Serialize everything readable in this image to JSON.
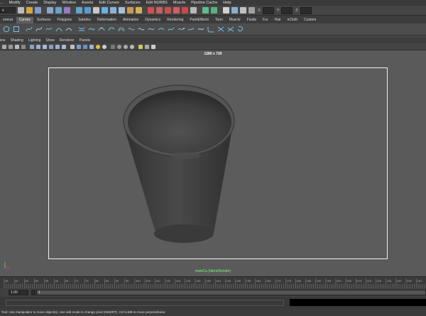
{
  "menubar": {
    "items": [
      "...",
      "Modify",
      "Create",
      "Display",
      "Window",
      "Assets",
      "Edit Curves",
      "Surfaces",
      "Edit NURBS",
      "Muscle",
      "Pipeline Cache",
      "Help"
    ]
  },
  "statusline": {
    "coord_labels": [
      "X:",
      "Y:",
      "Z:"
    ]
  },
  "shelf": {
    "tabs": [
      "eneral",
      "Curves",
      "Surfaces",
      "Polygons",
      "Subdivs",
      "Deformation",
      "Animation",
      "Dynamics",
      "Rendering",
      "PaintEffects",
      "Toon",
      "Muscle",
      "Fluids",
      "Fur",
      "Hair",
      "nCloth",
      "Custom"
    ],
    "active_tab": "Curves"
  },
  "panel": {
    "menus": [
      "iew",
      "Shading",
      "Lighting",
      "Show",
      "Renderer",
      "Panels"
    ]
  },
  "viewport": {
    "resolution_label": "1280 x 720",
    "camera_label": "mainCa (fabricRender)"
  },
  "timeline": {
    "ticks": [
      "35",
      "40",
      "45",
      "50",
      "55",
      "60",
      "65",
      "70",
      "75",
      "80",
      "85",
      "90",
      "95",
      "100",
      "105",
      "110",
      "115",
      "120",
      "125",
      "130",
      "135",
      "140",
      "145",
      "150",
      "155",
      "160",
      "165",
      "170",
      "175",
      "180",
      "185",
      "190",
      "195",
      "200",
      "205",
      "210",
      "215",
      "220",
      "225",
      "230",
      "235",
      "240"
    ]
  },
  "range": {
    "start_value": "1.00",
    "current_value": "1"
  },
  "helpline": {
    "text": "Tool: Use manipulator to move object(s). Use edit mode to change pivot (INSERT). Ctrl+LMB to move perpendicular."
  },
  "colors": {
    "viewport_bg": "#5a5a5a",
    "resolution_gate": "#f0f0f0",
    "camera_label": "#7df27d",
    "active_tab": "#5f5f5f"
  }
}
